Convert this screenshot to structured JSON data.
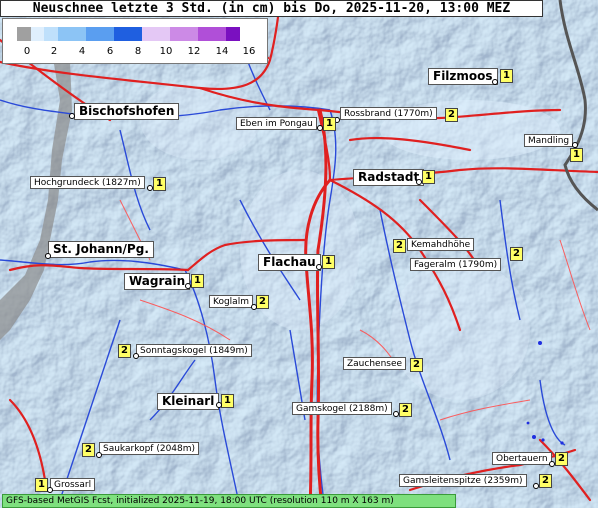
{
  "title": "Neuschnee letzte 3 Std. (in cm) bis Do, 2025-11-20, 13:00 MEZ",
  "legend": {
    "ticks": [
      "0",
      "2",
      "4",
      "6",
      "8",
      "10",
      "12",
      "14",
      "16"
    ],
    "colors": [
      "#a0a0a0",
      "#dfeffd",
      "#bfe0fb",
      "#8cc4f5",
      "#5a9ef0",
      "#1f5fe0",
      "#e4c8f5",
      "#cc8ae6",
      "#b04fd8",
      "#7a10c0"
    ]
  },
  "places": [
    {
      "name": "Filzmoos",
      "value": "1",
      "big": true
    },
    {
      "name": "Bischofshofen",
      "value": "",
      "big": true
    },
    {
      "name": "Rossbrand (1770m)",
      "value": "2",
      "big": false
    },
    {
      "name": "Eben im Pongau",
      "value": "1",
      "big": false
    },
    {
      "name": "Mandling",
      "value": "1",
      "big": false
    },
    {
      "name": "Radstadt",
      "value": "1",
      "big": true
    },
    {
      "name": "Hochgrundeck (1827m)",
      "value": "1",
      "big": false
    },
    {
      "name": "Kemahdhöhe",
      "value": "2",
      "big": false
    },
    {
      "name": "St. Johann/Pg.",
      "value": "",
      "big": true
    },
    {
      "name": "Fageralm (1790m)",
      "value": "2",
      "big": false
    },
    {
      "name": "Flachau",
      "value": "1",
      "big": true
    },
    {
      "name": "Wagrain",
      "value": "1",
      "big": true
    },
    {
      "name": "Koglalm",
      "value": "2",
      "big": false
    },
    {
      "name": "Sonntagskogel (1849m)",
      "value": "2",
      "big": false
    },
    {
      "name": "Zauchensee",
      "value": "2",
      "big": false
    },
    {
      "name": "Kleinarl",
      "value": "1",
      "big": true
    },
    {
      "name": "Gamskogel (2188m)",
      "value": "2",
      "big": false
    },
    {
      "name": "Saukarkopf (2048m)",
      "value": "2",
      "big": false
    },
    {
      "name": "Obertauern",
      "value": "2",
      "big": false
    },
    {
      "name": "Gamsleitenspitze (2359m)",
      "value": "2",
      "big": false
    },
    {
      "name": "Grossarl",
      "value": "1",
      "big": false
    }
  ],
  "footer": "GFS-based MetGIS Fcst, initialized 2025-11-19, 18:00 UTC  (resolution 110 m X 163 m)"
}
